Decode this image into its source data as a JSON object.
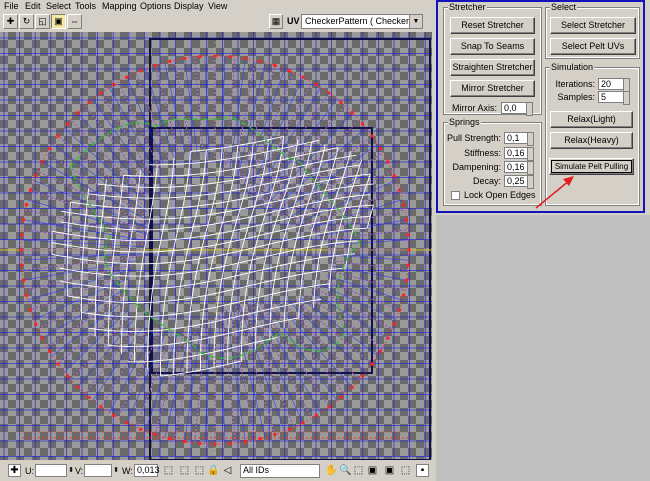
{
  "menu": [
    "File",
    "Edit",
    "Select",
    "Tools",
    "Mapping",
    "Options",
    "Display",
    "View"
  ],
  "toolbar": {
    "uv_label": "UV",
    "map_select_value": "CheckerPattern  ( Checker )"
  },
  "status": {
    "u_label": "U:",
    "u_value": "",
    "v_label": "V:",
    "v_value": "",
    "w_label": "W:",
    "w_value": "0,013",
    "id_filter": "All IDs"
  },
  "stretcher": {
    "title": "Stretcher",
    "reset": "Reset Stretcher",
    "snap": "Snap To Seams",
    "straighten": "Straighten Stretcher",
    "mirror": "Mirror Stretcher",
    "mirror_axis_label": "Mirror Axis:",
    "mirror_axis_value": "0,0"
  },
  "springs": {
    "title": "Springs",
    "pull_label": "Pull Strength:",
    "pull_value": "0,1",
    "stiffness_label": "Stiffness:",
    "stiffness_value": "0,16",
    "dampening_label": "Dampening:",
    "dampening_value": "0,16",
    "decay_label": "Decay:",
    "decay_value": "0,25",
    "lock_label": "Lock Open Edges",
    "lock_checked": false
  },
  "select": {
    "title": "Select",
    "select_stretcher": "Select Stretcher",
    "select_pelt": "Select Pelt UVs"
  },
  "simulation": {
    "title": "Simulation",
    "iterations_label": "Iterations:",
    "iterations_value": "20",
    "samples_label": "Samples:",
    "samples_value": "5",
    "relax_light": "Relax(Light)",
    "relax_heavy": "Relax(Heavy)",
    "simulate": "Simulate Pelt Pulling"
  },
  "colors": {
    "panel_border": "#1313b8",
    "uv_grid": "#2222dd",
    "stretcher_points": "#ff2020",
    "mesh": "#ffffff",
    "seams": "#30c030",
    "arrow": "#e02020"
  }
}
